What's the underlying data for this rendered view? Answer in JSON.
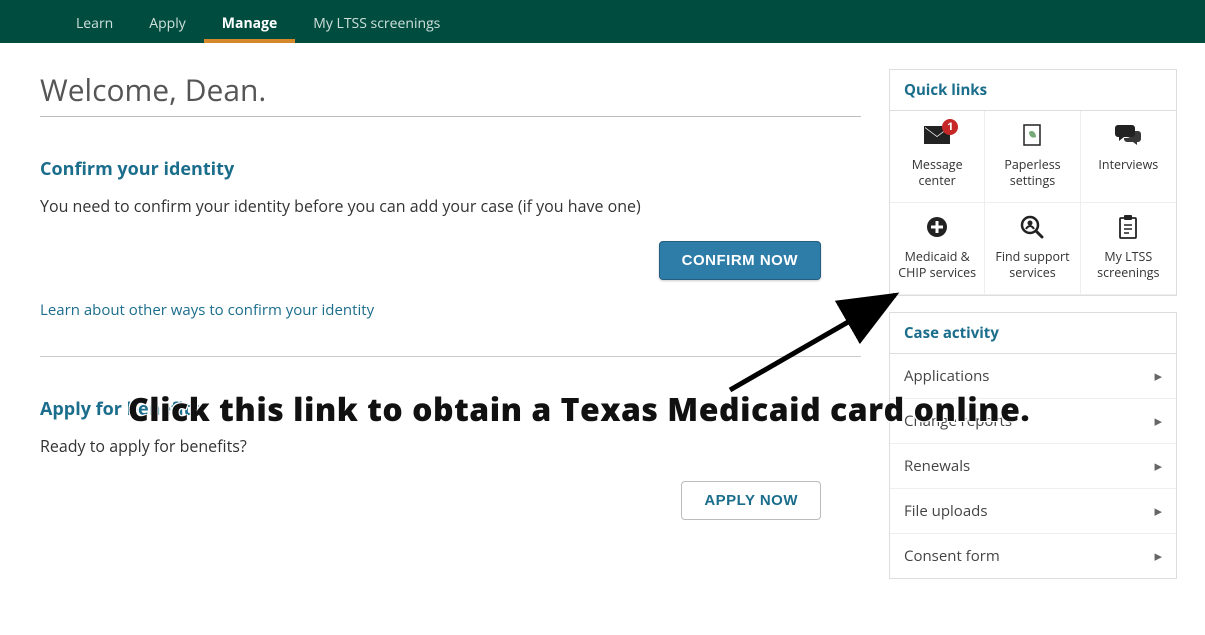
{
  "nav": {
    "items": [
      "Learn",
      "Apply",
      "Manage",
      "My LTSS screenings"
    ],
    "activeIndex": 2
  },
  "welcome": "Welcome, Dean.",
  "confirm": {
    "title": "Confirm your identity",
    "text": "You need to confirm your identity before you can add your case (if you have one)",
    "button": "CONFIRM NOW",
    "link": "Learn about other ways to confirm your identity"
  },
  "apply": {
    "title": "Apply for benefits",
    "text": "Ready to apply for benefits?",
    "button": "APPLY NOW"
  },
  "quicklinks": {
    "header": "Quick links",
    "items": [
      {
        "label": "Message center",
        "icon": "envelope",
        "badge": "1"
      },
      {
        "label": "Paperless settings",
        "icon": "doc-leaf"
      },
      {
        "label": "Interviews",
        "icon": "chat"
      },
      {
        "label": "Medicaid & CHIP services",
        "icon": "plus-circle"
      },
      {
        "label": "Find support services",
        "icon": "search-person"
      },
      {
        "label": "My LTSS screenings",
        "icon": "clipboard"
      }
    ]
  },
  "caseActivity": {
    "header": "Case activity",
    "items": [
      "Applications",
      "Change reports",
      "Renewals",
      "File uploads",
      "Consent form"
    ]
  },
  "annotation": {
    "text": "Click  this link to obtain a Texas Medicaid card online."
  }
}
